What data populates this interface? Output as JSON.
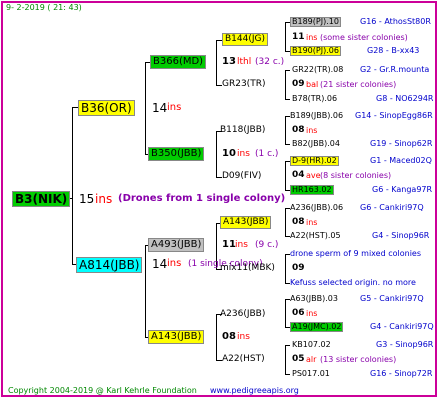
{
  "header": {
    "date": "9-  2-2019 ( 21: 43)"
  },
  "footer": {
    "copyright": "Copyright 2004-2019 @ Karl Kehrle Foundation",
    "site": "www.pedigreeapis.org"
  },
  "root": {
    "name": "B3(NIK)",
    "num": "15",
    "ins": "ins",
    "note": "(Drones from 1 single colony)"
  },
  "gen1": [
    {
      "name": "B36(OR)",
      "num": "14",
      "ins": "ins"
    },
    {
      "name": "A814(JBB)",
      "num": "14",
      "ins": "ins",
      "note": "(1 single colony)"
    }
  ],
  "gen2": [
    {
      "name": "B366(MD)",
      "num": "13",
      "ins": "lthl",
      "note": "(32 c.)"
    },
    {
      "name": "B350(JBB)",
      "num": "10",
      "ins": "ins",
      "note": "(1 c.)"
    },
    {
      "name": "A493(JBB)",
      "num": "11",
      "ins": "ins",
      "note": "(9 c.)"
    },
    {
      "name": "A143(JBB)",
      "num": "08",
      "ins": "ins"
    }
  ],
  "gen3": [
    {
      "name": "B144(JG)"
    },
    {
      "name": "GR23(TR)"
    },
    {
      "name": "B118(JBB)"
    },
    {
      "name": "D09(FIV)"
    },
    {
      "name": "A143(JBB)",
      "num": "08",
      "ins": "ins"
    },
    {
      "name": "mix11(MBK)"
    },
    {
      "name": "A236(JBB)"
    },
    {
      "name": "A22(HST)"
    }
  ],
  "gen4": [
    {
      "name": "B189(PJ).10",
      "right": "G16 - AthosSt80R"
    },
    {
      "name": "11",
      "ins": "ins",
      "note": "(some sister colonies)"
    },
    {
      "name": "B190(PJ).06",
      "right": "G28 - B-xx43"
    },
    {
      "name": "GR22(TR).08",
      "right": "G2 - Gr.R.mounta"
    },
    {
      "name": "09",
      "ins": "bal",
      "note": "(21 sister colonies)"
    },
    {
      "name": "B78(TR).06",
      "right": "G8 - NO6294R"
    },
    {
      "name": "B189(JBB).06",
      "right": "G14 - SinopEgg86R"
    },
    {
      "name": "08",
      "ins": "ins"
    },
    {
      "name": "B82(JBB).04",
      "right": "G19 - Sinop62R"
    },
    {
      "name": "D-9(HR).02",
      "right": "G1 - Maced02Q"
    },
    {
      "name": "04",
      "ins": "ave",
      "note": "(8 sister colonies)"
    },
    {
      "name": "HR163.02",
      "right": "G6 - Kanga97R"
    },
    {
      "name": "A236(JBB).06",
      "right": "G6 - Cankiri97Q"
    },
    {
      "name": "08",
      "ins": "ins"
    },
    {
      "name": "A22(HST).05",
      "right": "G4 - Sinop96R"
    },
    {
      "name": "drone sperm of 9 mixed colonies"
    },
    {
      "name": "09"
    },
    {
      "name": "Kefuss selected origin.  no more"
    },
    {
      "name": "A63(JBB).03",
      "right": "G5 - Cankiri97Q"
    },
    {
      "name": "06",
      "ins": "ins"
    },
    {
      "name": "A19(JMC).02",
      "right": "G4 - Cankiri97Q"
    },
    {
      "name": "KB107.02",
      "right": "G3 - Sinop96R"
    },
    {
      "name": "05",
      "ins": "alr",
      "note": "(13 sister colonies)"
    },
    {
      "name": "PS017.01",
      "right": "G16 - Sinop72R"
    }
  ]
}
